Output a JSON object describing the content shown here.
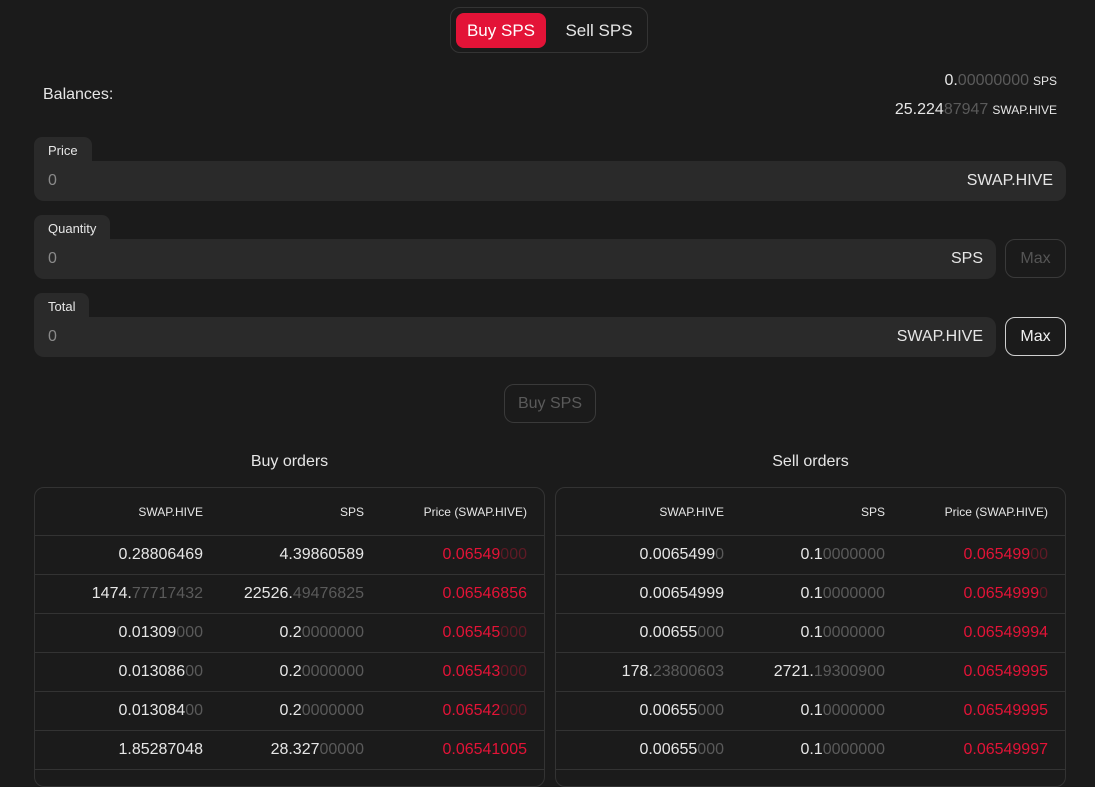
{
  "toggle": {
    "buy_label": "Buy SPS",
    "sell_label": "Sell SPS"
  },
  "balances": {
    "label": "Balances:",
    "sps": {
      "main": "0.",
      "dim": "00000000",
      "unit": "SPS"
    },
    "swap_hive": {
      "main": "25.224",
      "dim": "87947",
      "unit": "SWAP.HIVE"
    }
  },
  "form": {
    "price": {
      "label": "Price",
      "value": "0",
      "unit": "SWAP.HIVE"
    },
    "quantity": {
      "label": "Quantity",
      "value": "0",
      "unit": "SPS",
      "max_label": "Max"
    },
    "total": {
      "label": "Total",
      "value": "0",
      "unit": "SWAP.HIVE",
      "max_label": "Max"
    },
    "submit_label": "Buy SPS"
  },
  "buy_orders": {
    "title": "Buy orders",
    "headers": [
      "SWAP.HIVE",
      "SPS",
      "Price (SWAP.HIVE)"
    ],
    "rows": [
      [
        [
          "0.28806469",
          ""
        ],
        [
          "4.39860589",
          ""
        ],
        [
          "0.06549",
          "000"
        ]
      ],
      [
        [
          "1474.",
          "77717432"
        ],
        [
          "22526.",
          "49476825"
        ],
        [
          "0.06546856",
          ""
        ]
      ],
      [
        [
          "0.01309",
          "000"
        ],
        [
          "0.2",
          "0000000"
        ],
        [
          "0.06545",
          "000"
        ]
      ],
      [
        [
          "0.013086",
          "00"
        ],
        [
          "0.2",
          "0000000"
        ],
        [
          "0.06543",
          "000"
        ]
      ],
      [
        [
          "0.013084",
          "00"
        ],
        [
          "0.2",
          "0000000"
        ],
        [
          "0.06542",
          "000"
        ]
      ],
      [
        [
          "1.85287048",
          ""
        ],
        [
          "28.327",
          "00000"
        ],
        [
          "0.06541005",
          ""
        ]
      ]
    ]
  },
  "sell_orders": {
    "title": "Sell orders",
    "headers": [
      "SWAP.HIVE",
      "SPS",
      "Price (SWAP.HIVE)"
    ],
    "rows": [
      [
        [
          "0.0065499",
          "0"
        ],
        [
          "0.1",
          "0000000"
        ],
        [
          "0.065499",
          "00"
        ]
      ],
      [
        [
          "0.00654999",
          ""
        ],
        [
          "0.1",
          "0000000"
        ],
        [
          "0.0654999",
          "0"
        ]
      ],
      [
        [
          "0.00655",
          "000"
        ],
        [
          "0.1",
          "0000000"
        ],
        [
          "0.06549994",
          ""
        ]
      ],
      [
        [
          "178.",
          "23800603"
        ],
        [
          "2721.",
          "19300900"
        ],
        [
          "0.06549995",
          ""
        ]
      ],
      [
        [
          "0.00655",
          "000"
        ],
        [
          "0.1",
          "0000000"
        ],
        [
          "0.06549995",
          ""
        ]
      ],
      [
        [
          "0.00655",
          "000"
        ],
        [
          "0.1",
          "0000000"
        ],
        [
          "0.06549997",
          ""
        ]
      ]
    ]
  }
}
